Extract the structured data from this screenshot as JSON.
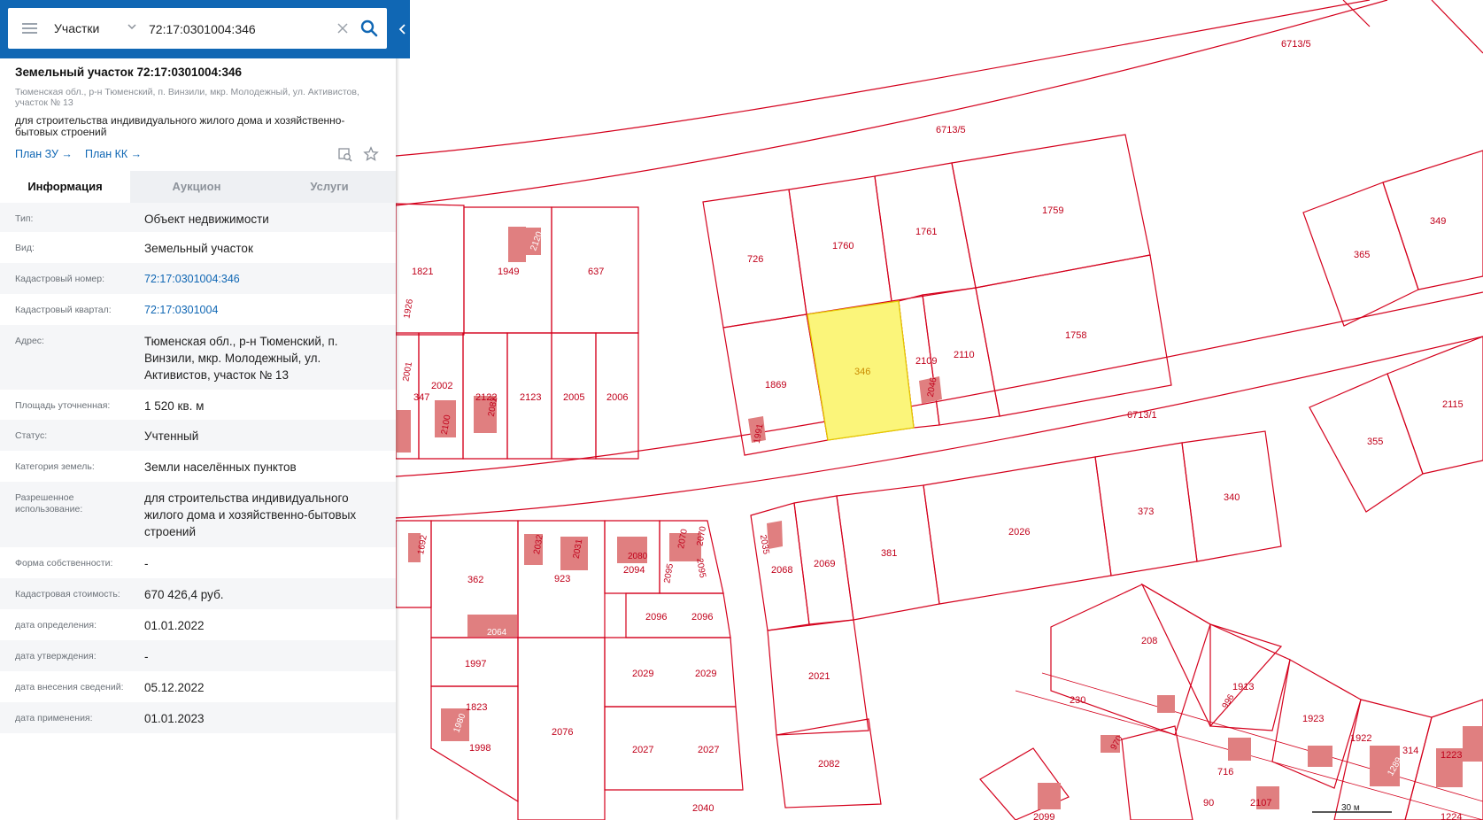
{
  "search": {
    "layer": "Участки",
    "query": "72:17:0301004:346"
  },
  "parcel": {
    "title": "Земельный участок 72:17:0301004:346",
    "address_short": "Тюменская обл., р-н Тюменский, п. Винзили, мкр. Молодежный, ул. Активистов, участок № 13",
    "purpose": "для строительства индивидуального жилого дома и хозяйственно-бытовых строений",
    "links": {
      "plan_zu": "План ЗУ →",
      "plan_kk": "План КК →"
    }
  },
  "tabs": [
    {
      "label": "Информация",
      "active": true
    },
    {
      "label": "Аукцион",
      "active": false
    },
    {
      "label": "Услуги",
      "active": false
    }
  ],
  "info": [
    {
      "key": "Тип:",
      "value": "Объект недвижимости"
    },
    {
      "key": "Вид:",
      "value": "Земельный участок"
    },
    {
      "key": "Кадастровый номер:",
      "value": "72:17:0301004:346",
      "link": true
    },
    {
      "key": "Кадастровый квартал:",
      "value": "72:17:0301004",
      "link": true
    },
    {
      "key": "Адрес:",
      "value": "Тюменская обл., р-н Тюменский, п. Винзили, мкр. Молодежный, ул. Активистов, участок № 13"
    },
    {
      "key": "Площадь уточненная:",
      "value": "1 520 кв. м"
    },
    {
      "key": "Статус:",
      "value": "Учтенный"
    },
    {
      "key": "Категория земель:",
      "value": "Земли населённых пунктов"
    },
    {
      "key": "Разрешенное использование:",
      "value": "для строительства индивидуального жилого дома и хозяйственно-бытовых строений"
    },
    {
      "key": "Форма собственности:",
      "value": "-"
    },
    {
      "key": "Кадастровая стоимость:",
      "value": "670 426,4 руб."
    },
    {
      "key": "дата определения:",
      "value": "01.01.2022"
    },
    {
      "key": "дата утверждения:",
      "value": "-"
    },
    {
      "key": "дата внесения сведений:",
      "value": "05.12.2022"
    },
    {
      "key": "дата применения:",
      "value": "01.01.2023"
    }
  ],
  "map": {
    "line_color": "#d4001c",
    "label_color": "#c0001a",
    "highlight_fill": "#fbf57a",
    "highlight_stroke": "#e5c900",
    "highlight_label_color": "#c98a00",
    "building_fill": "#e07f80",
    "labels": {
      "l6713_5a": "6713/5",
      "l6713_5b": "6713/5",
      "l6713_1": "6713/1",
      "l726": "726",
      "l1760": "1760",
      "l1761": "1761",
      "l1759": "1759",
      "l1869": "1869",
      "l346": "346",
      "l2109": "2109",
      "l2110": "2110",
      "l1758": "1758",
      "l2046": "2046",
      "l1991": "1991",
      "l365": "365",
      "l349": "349",
      "l2115": "2115",
      "l355": "355",
      "l1821": "1821",
      "l1949": "1949",
      "l2120": "2120",
      "l637": "637",
      "l1926": "1926",
      "l2001": "2001",
      "l347": "347",
      "l2002": "2002",
      "l2100": "2100",
      "l2122": "2122",
      "l2082b": "2082",
      "l2123": "2123",
      "l2005": "2005",
      "l2006": "2006",
      "l1692": "1692",
      "l362": "362",
      "l2032": "2032",
      "l2031": "2031",
      "l923": "923",
      "l2080": "2080",
      "l2094": "2094",
      "l2070a": "2070",
      "l2070b": "2070",
      "l2095a": "2095",
      "l2095b": "2095",
      "l2064": "2064",
      "l2096a": "2096",
      "l2096b": "2096",
      "l1997": "1997",
      "l2029a": "2029",
      "l2029b": "2029",
      "l1823": "1823",
      "l1998": "1998",
      "l1980": "1980",
      "l2076": "2076",
      "l2027a": "2027",
      "l2027b": "2027",
      "l2040": "2040",
      "l2035": "2035",
      "l2068": "2068",
      "l2069": "2069",
      "l381": "381",
      "l2026": "2026",
      "l373": "373",
      "l340": "340",
      "l2021": "2021",
      "l2082": "2082",
      "l208": "208",
      "l230": "230",
      "l1913": "1913",
      "l1923": "1923",
      "l1922": "1922",
      "l314": "314",
      "l1223": "1223",
      "l1224": "1224",
      "l716": "716",
      "l90": "90",
      "l2107": "2107",
      "l2099": "2099",
      "l970": "970",
      "l996": "996",
      "l1289": "1289"
    },
    "scale_label": "30 м"
  }
}
